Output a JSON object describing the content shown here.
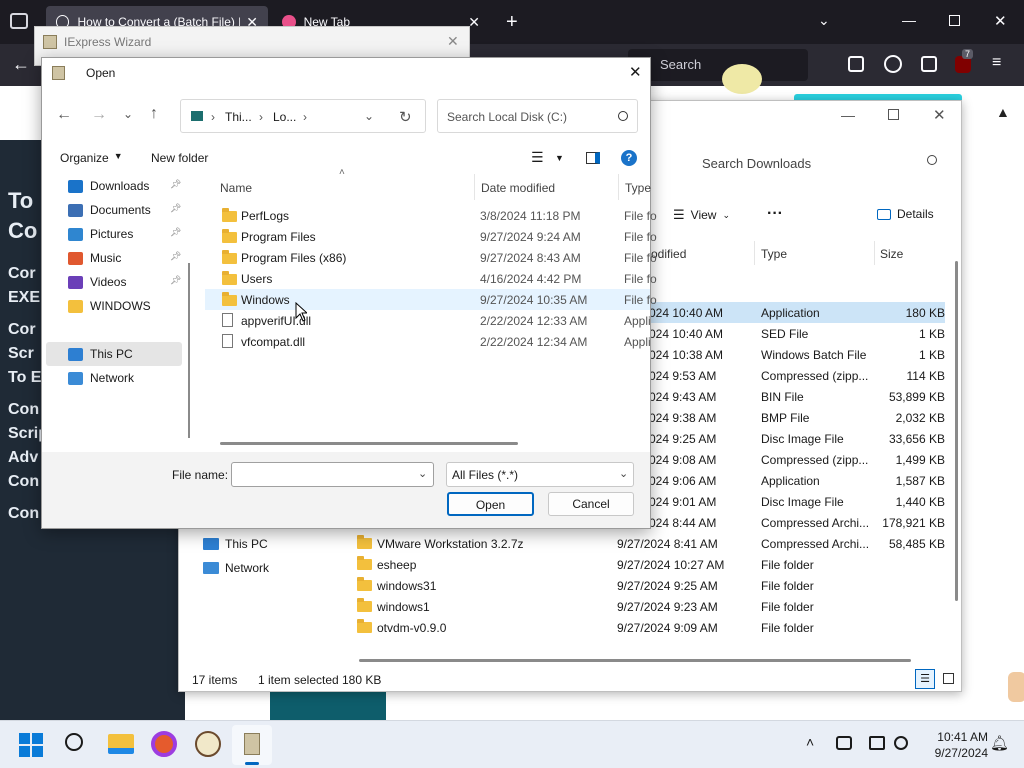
{
  "browser": {
    "tabs": [
      {
        "label": "How to Convert a (Batch File) E"
      },
      {
        "label": "New Tab"
      }
    ],
    "search_placeholder": "Search",
    "badge_count": "7",
    "page_headings": [
      "To",
      "Co"
    ],
    "page_lines": [
      "Cor",
      "EXE",
      "Cor",
      "Scr",
      "To E",
      "Con",
      "Scrip",
      "Adv",
      "Con",
      "Con"
    ]
  },
  "iexpress": {
    "title": "IExpress Wizard"
  },
  "open_dialog": {
    "title": "Open",
    "breadcrumb": [
      "Thi...",
      "Lo..."
    ],
    "search_placeholder": "Search Local Disk (C:)",
    "organize_label": "Organize",
    "new_folder_label": "New folder",
    "nav": [
      {
        "label": "Downloads",
        "pinned": true
      },
      {
        "label": "Documents",
        "pinned": true
      },
      {
        "label": "Pictures",
        "pinned": true
      },
      {
        "label": "Music",
        "pinned": true
      },
      {
        "label": "Videos",
        "pinned": true
      },
      {
        "label": "WINDOWS",
        "pinned": false
      },
      {
        "label": "This PC",
        "pinned": false
      },
      {
        "label": "Network",
        "pinned": false
      }
    ],
    "columns": [
      "Name",
      "Date modified",
      "Type"
    ],
    "files": [
      {
        "name": "PerfLogs",
        "date": "3/8/2024 11:18 PM",
        "type": "File fo",
        "kind": "folder"
      },
      {
        "name": "Program Files",
        "date": "9/27/2024 9:24 AM",
        "type": "File fo",
        "kind": "folder"
      },
      {
        "name": "Program Files (x86)",
        "date": "9/27/2024 8:43 AM",
        "type": "File fo",
        "kind": "folder"
      },
      {
        "name": "Users",
        "date": "4/16/2024 4:42 PM",
        "type": "File fo",
        "kind": "folder"
      },
      {
        "name": "Windows",
        "date": "9/27/2024 10:35 AM",
        "type": "File fo",
        "kind": "folder"
      },
      {
        "name": "appverifUI.dll",
        "date": "2/22/2024 12:33 AM",
        "type": "Appli",
        "kind": "file"
      },
      {
        "name": "vfcompat.dll",
        "date": "2/22/2024 12:34 AM",
        "type": "Appli",
        "kind": "file"
      }
    ],
    "filename_label": "File name:",
    "filename_value": "",
    "filter": "All Files (*.*)",
    "open_label": "Open",
    "cancel_label": "Cancel"
  },
  "explorer": {
    "search_placeholder": "Search Downloads",
    "view_label": "View",
    "details_label": "Details",
    "columns": [
      "odified",
      "Type",
      "Size"
    ],
    "rows": [
      {
        "date": "024 10:40 AM",
        "type": "Application",
        "size": "180 KB"
      },
      {
        "date": "024 10:40 AM",
        "type": "SED File",
        "size": "1 KB"
      },
      {
        "date": "024 10:38 AM",
        "type": "Windows Batch File",
        "size": "1 KB"
      },
      {
        "date": "024 9:53 AM",
        "type": "Compressed (zipp...",
        "size": "114 KB"
      },
      {
        "date": "024 9:43 AM",
        "type": "BIN File",
        "size": "53,899 KB"
      },
      {
        "date": "024 9:38 AM",
        "type": "BMP File",
        "size": "2,032 KB"
      },
      {
        "date": "024 9:25 AM",
        "type": "Disc Image File",
        "size": "33,656 KB"
      },
      {
        "date": "024 9:08 AM",
        "type": "Compressed (zipp...",
        "size": "1,499 KB"
      },
      {
        "date": "024 9:06 AM",
        "type": "Application",
        "size": "1,587 KB"
      },
      {
        "date": "024 9:01 AM",
        "type": "Disc Image File",
        "size": "1,440 KB"
      },
      {
        "date": "024 8:44 AM",
        "type": "Compressed Archi...",
        "size": "178,921 KB"
      },
      {
        "name": "VMware Workstation 3.2.7z",
        "date": "9/27/2024 8:41 AM",
        "type": "Compressed Archi...",
        "size": "58,485 KB"
      },
      {
        "name": "esheep",
        "date": "9/27/2024 10:27 AM",
        "type": "File folder",
        "size": ""
      },
      {
        "name": "windows31",
        "date": "9/27/2024 9:25 AM",
        "type": "File folder",
        "size": ""
      },
      {
        "name": "windows1",
        "date": "9/27/2024 9:23 AM",
        "type": "File folder",
        "size": ""
      },
      {
        "name": "otvdm-v0.9.0",
        "date": "9/27/2024 9:09 AM",
        "type": "File folder",
        "size": ""
      }
    ],
    "nav": [
      "This PC",
      "Network"
    ],
    "status_items": "17 items",
    "status_selected": "1 item selected",
    "status_size": "180 KB"
  },
  "taskbar": {
    "time": "10:41 AM",
    "date": "9/27/2024"
  },
  "colors": {
    "accent": "#0067c0",
    "selection": "#cce4f7",
    "hover": "#e5f3ff"
  }
}
